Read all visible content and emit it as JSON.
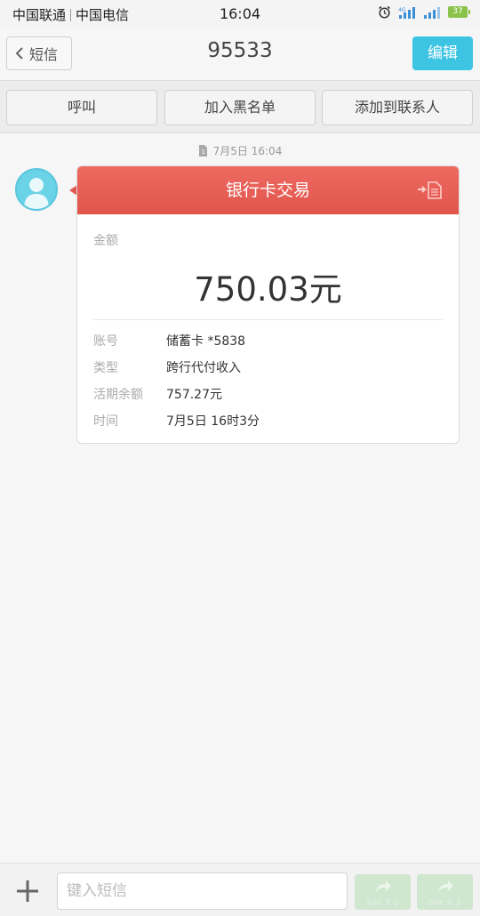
{
  "status_bar": {
    "carrier1": "中国联通",
    "carrier2": "中国电信",
    "time": "16:04",
    "battery": "37"
  },
  "header": {
    "back_label": "短信",
    "title": "95533",
    "edit_label": "编辑"
  },
  "actions": {
    "call": "呼叫",
    "blacklist": "加入黑名单",
    "add_contact": "添加到联系人"
  },
  "message": {
    "timestamp": "7月5日 16:04",
    "card_title": "银行卡交易",
    "amount_label": "金额",
    "amount": "750.03元",
    "rows": [
      {
        "key": "账号",
        "value": "储蓄卡 *5838"
      },
      {
        "key": "类型",
        "value": "跨行代付收入"
      },
      {
        "key": "活期余额",
        "value": "757.27元"
      },
      {
        "key": "时间",
        "value": "7月5日 16时3分"
      }
    ]
  },
  "compose": {
    "placeholder": "键入短信",
    "sim1_label": "SIM 卡 1",
    "sim2_label": "SIM 卡 2"
  },
  "colors": {
    "accent": "#3ec4e3",
    "card_header": "#e65d54",
    "send_disabled": "#cfe6cf"
  }
}
